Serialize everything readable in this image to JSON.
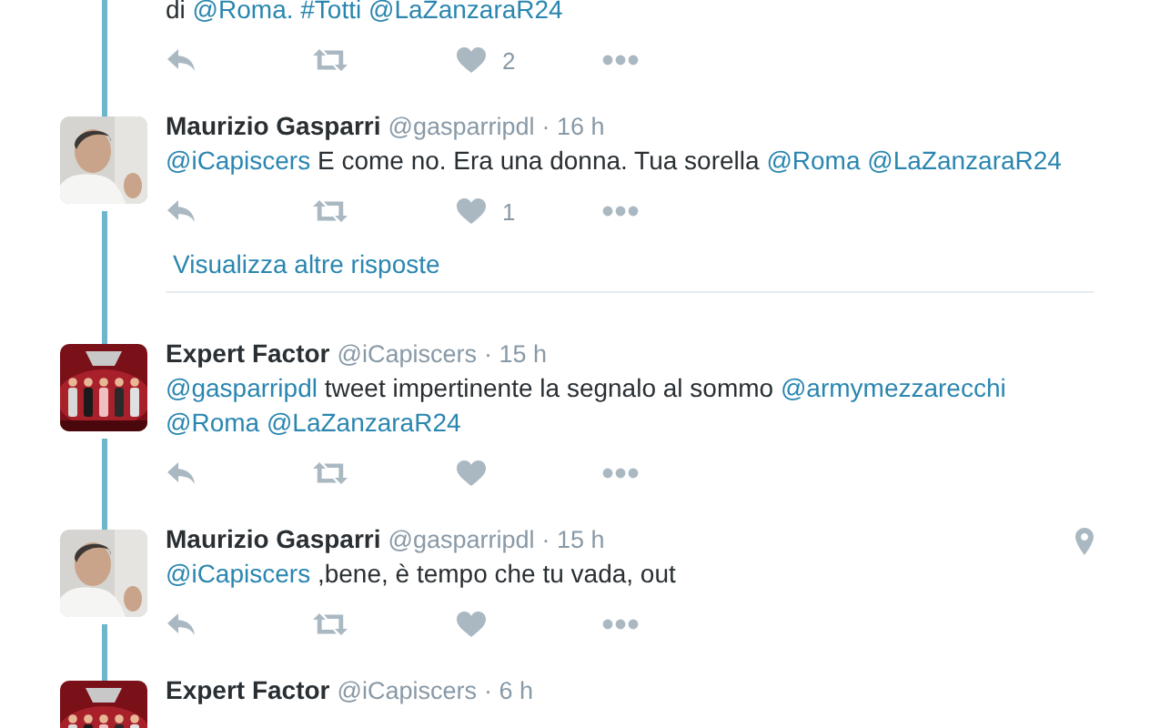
{
  "tweets": [
    {
      "body": [
        {
          "kind": "text",
          "text": "di"
        },
        {
          "kind": "mention",
          "text": "@Roma."
        },
        {
          "kind": "mention",
          "text": "#Totti"
        },
        {
          "kind": "mention",
          "text": "@LaZanzaraR24"
        }
      ],
      "actions": [
        {
          "kind": "reply"
        },
        {
          "kind": "retweet"
        },
        {
          "kind": "like",
          "count": "2"
        },
        {
          "kind": "more"
        }
      ]
    },
    {
      "avatar": {
        "kind": "picture"
      },
      "name": "Maurizio Gasparri",
      "handle": "@gasparripdl",
      "time": "· 16 h",
      "body": [
        {
          "kind": "mention",
          "text": "@iCapiscers"
        },
        {
          "kind": "text",
          "text": "E come no. Era una donna. Tua sorella"
        },
        {
          "kind": "mention",
          "text": "@Roma"
        },
        {
          "kind": "mention",
          "text": "@LaZanzaraR24"
        }
      ],
      "actions": [
        {
          "kind": "reply"
        },
        {
          "kind": "retweet"
        },
        {
          "kind": "like",
          "count": "1"
        },
        {
          "kind": "more"
        }
      ],
      "more_replies": "Visualizza altre risposte"
    },
    {
      "avatar": {
        "kind": "picture"
      },
      "name": "Expert Factor",
      "handle": "@iCapiscers",
      "time": "· 15 h",
      "body": [
        {
          "kind": "mention",
          "text": "@gasparripdl"
        },
        {
          "kind": "text",
          "text": "tweet impertinente la segnalo al sommo"
        },
        {
          "kind": "mention",
          "text": "@armymezzarecchi"
        },
        {
          "kind": "mention",
          "text": "@Roma"
        },
        {
          "kind": "mention",
          "text": "@LaZanzaraR24"
        }
      ],
      "actions": [
        {
          "kind": "reply"
        },
        {
          "kind": "retweet"
        },
        {
          "kind": "like"
        },
        {
          "kind": "more"
        }
      ]
    },
    {
      "avatar": {
        "kind": "picture"
      },
      "name": "Maurizio Gasparri",
      "handle": "@gasparripdl",
      "time": "· 15 h",
      "geo": true,
      "body": [
        {
          "kind": "mention",
          "text": "@iCapiscers"
        },
        {
          "kind": "text",
          "text": ",bene, è tempo che tu vada, out"
        }
      ],
      "actions": [
        {
          "kind": "reply"
        },
        {
          "kind": "retweet"
        },
        {
          "kind": "like"
        },
        {
          "kind": "more"
        }
      ]
    },
    {
      "avatar": {
        "kind": "picture"
      },
      "name": "Expert Factor",
      "handle": "@iCapiscers",
      "time": "· 6 h"
    }
  ]
}
